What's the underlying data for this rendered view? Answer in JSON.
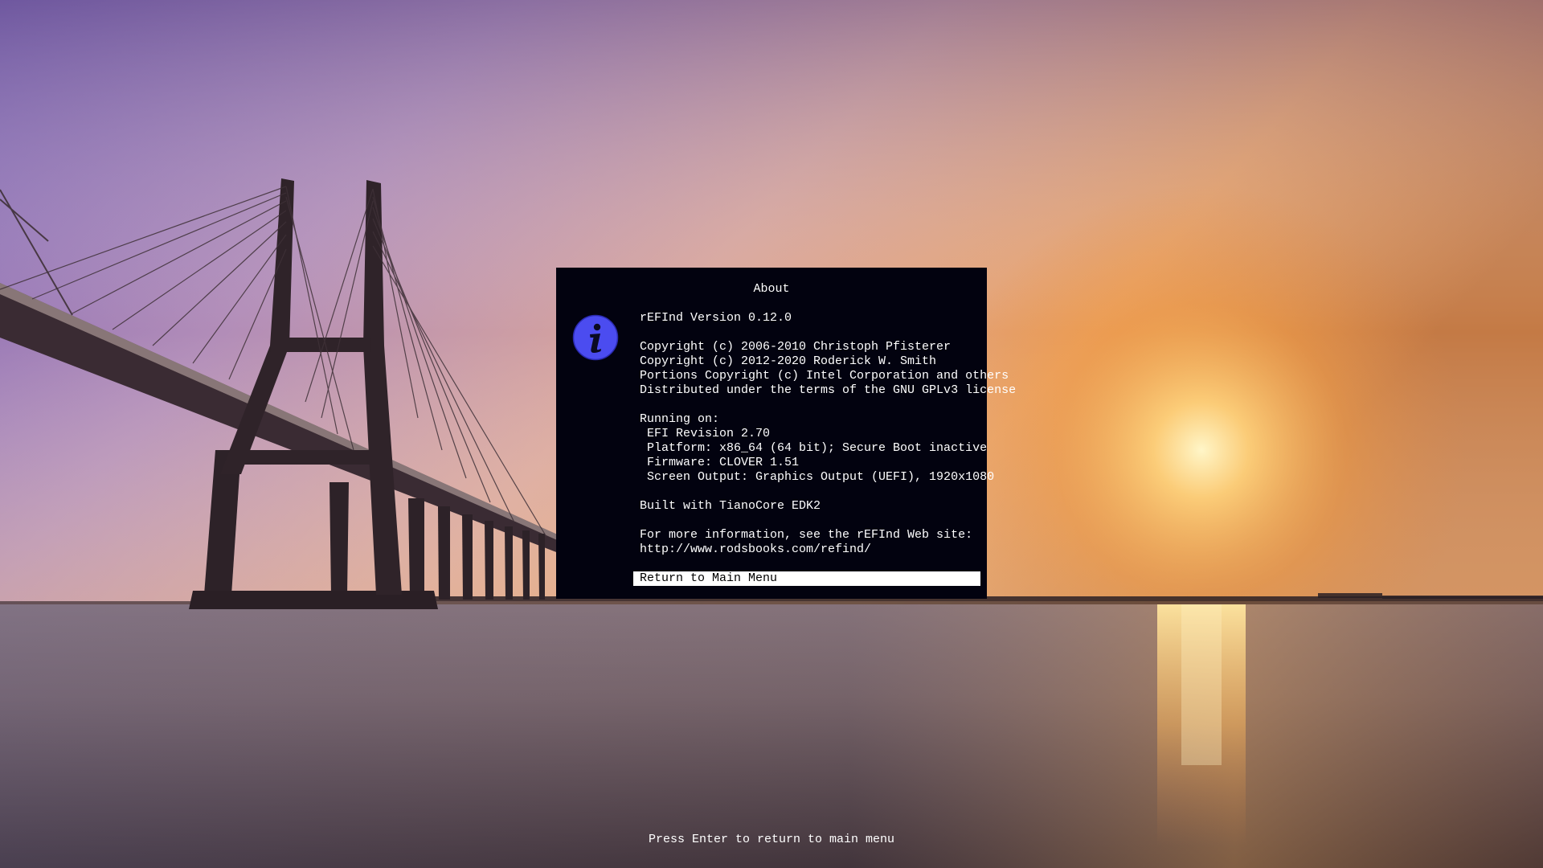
{
  "dialog": {
    "title": "About",
    "lines": [
      "rEFInd Version 0.12.0",
      "",
      "Copyright (c) 2006-2010 Christoph Pfisterer",
      "Copyright (c) 2012-2020 Roderick W. Smith",
      "Portions Copyright (c) Intel Corporation and others",
      "Distributed under the terms of the GNU GPLv3 license",
      "",
      "Running on:",
      " EFI Revision 2.70",
      " Platform: x86_64 (64 bit); Secure Boot inactive",
      " Firmware: CLOVER 1.51",
      " Screen Output: Graphics Output (UEFI), 1920x1080",
      "",
      "Built with TianoCore EDK2",
      "",
      "For more information, see the rEFInd Web site:",
      "http://www.rodsbooks.com/refind/"
    ],
    "icon": "info-icon",
    "menu_item": "Return to Main Menu"
  },
  "footer": {
    "hint": "Press Enter to return to main menu"
  },
  "colors": {
    "dialog_bg": "#02020f",
    "icon_fill": "#4b4cf0",
    "highlight_bg": "#ffffff"
  }
}
